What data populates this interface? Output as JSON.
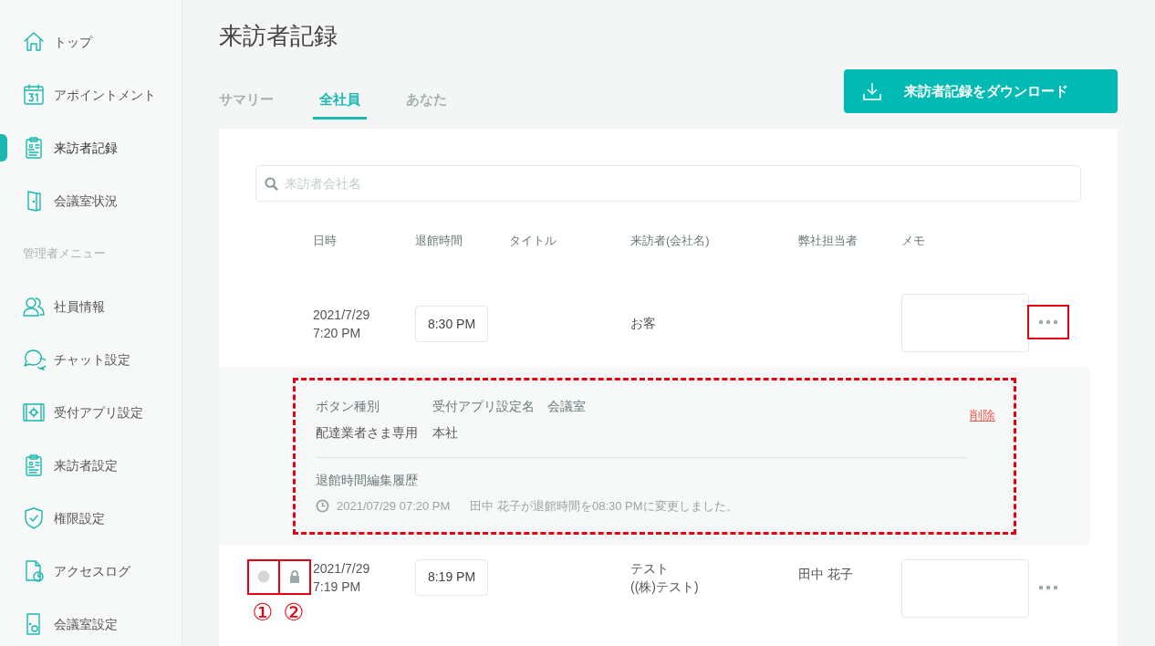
{
  "sidebar": {
    "items": [
      {
        "label": "トップ",
        "selected": false
      },
      {
        "label": "アポイントメント",
        "selected": false
      },
      {
        "label": "来訪者記録",
        "selected": true
      },
      {
        "label": "会議室状況",
        "selected": false
      }
    ],
    "section_label": "管理者メニュー",
    "admin_items": [
      {
        "label": "社員情報",
        "selected": false
      },
      {
        "label": "チャット設定",
        "selected": false
      },
      {
        "label": "受付アプリ設定",
        "selected": false
      },
      {
        "label": "来訪者設定",
        "selected": false
      },
      {
        "label": "権限設定",
        "selected": false
      },
      {
        "label": "アクセスログ",
        "selected": false
      },
      {
        "label": "会議室設定",
        "selected": false
      }
    ]
  },
  "title": "来訪者記録",
  "tabs": [
    {
      "label": "サマリー",
      "selected": false
    },
    {
      "label": "全社員",
      "selected": true
    },
    {
      "label": "あなた",
      "selected": false
    }
  ],
  "download_button": "来訪者記録をダウンロード",
  "search": {
    "placeholder": "来訪者会社名"
  },
  "columns": [
    "日時",
    "退館時間",
    "タイトル",
    "来訪者(会社名)",
    "弊社担当者",
    "メモ"
  ],
  "rows": [
    {
      "date": "2021/7/29",
      "time": "7:20 PM",
      "exit_time": "8:30 PM",
      "visitor": [
        "お客"
      ],
      "menu_highlighted": true,
      "detail": {
        "highlighted": true,
        "headers": [
          "ボタン種別",
          "受付アプリ設定名",
          "会議室"
        ],
        "values": [
          "配達業者さま専用",
          "本社"
        ],
        "delete_link": "削除",
        "history_title": "退館時間編集履歴",
        "history": [
          {
            "time": "2021/07/29 07:20 PM",
            "text": "田中 花子が退館時間を08:30 PMに変更しました。"
          }
        ]
      }
    },
    {
      "date": "2021/7/29",
      "time": "7:19 PM",
      "exit_time": "8:19 PM",
      "visitor": [
        "テスト",
        "((株)テスト)"
      ],
      "host": "田中 花子",
      "menu_highlighted": false,
      "indicators": [
        {
          "kind": "dot",
          "label": "①"
        },
        {
          "kind": "lock",
          "label": "②"
        }
      ]
    }
  ]
}
